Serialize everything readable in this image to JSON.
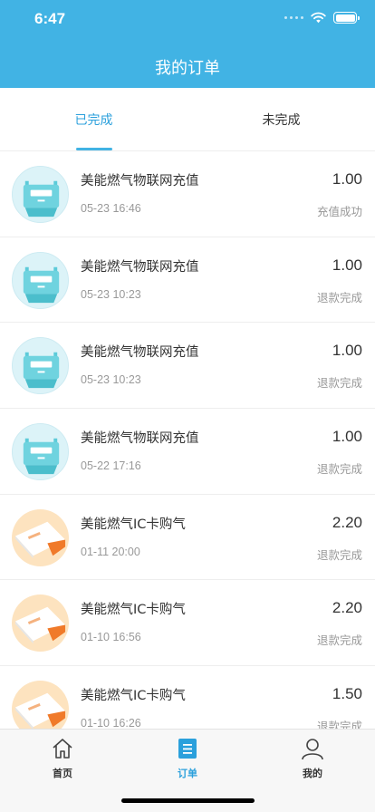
{
  "status_bar": {
    "time": "6:47"
  },
  "header": {
    "title": "我的订单"
  },
  "tabs": [
    {
      "label": "已完成",
      "active": true
    },
    {
      "label": "未完成",
      "active": false
    }
  ],
  "orders": [
    {
      "thumb": "gas-meter",
      "title": "美能燃气物联网充值",
      "date": "05-23 16:46",
      "amount": "1.00",
      "status": "充值成功"
    },
    {
      "thumb": "gas-meter",
      "title": "美能燃气物联网充值",
      "date": "05-23 10:23",
      "amount": "1.00",
      "status": "退款完成"
    },
    {
      "thumb": "gas-meter",
      "title": "美能燃气物联网充值",
      "date": "05-23 10:23",
      "amount": "1.00",
      "status": "退款完成"
    },
    {
      "thumb": "gas-meter",
      "title": "美能燃气物联网充值",
      "date": "05-22 17:16",
      "amount": "1.00",
      "status": "退款完成"
    },
    {
      "thumb": "ic-card",
      "title": "美能燃气IC卡购气",
      "date": "01-11 20:00",
      "amount": "2.20",
      "status": "退款完成"
    },
    {
      "thumb": "ic-card",
      "title": "美能燃气IC卡购气",
      "date": "01-10 16:56",
      "amount": "2.20",
      "status": "退款完成"
    },
    {
      "thumb": "ic-card",
      "title": "美能燃气IC卡购气",
      "date": "01-10 16:26",
      "amount": "1.50",
      "status": "退款完成"
    }
  ],
  "tabbar": [
    {
      "label": "首页",
      "icon": "home-icon",
      "active": false
    },
    {
      "label": "订单",
      "icon": "order-list-icon",
      "active": true
    },
    {
      "label": "我的",
      "icon": "user-icon",
      "active": false
    }
  ],
  "colors": {
    "primary": "#41b3e4",
    "active_text": "#2ba0dc",
    "meter": "#5ccbd9",
    "card_orange": "#f07a2a"
  }
}
